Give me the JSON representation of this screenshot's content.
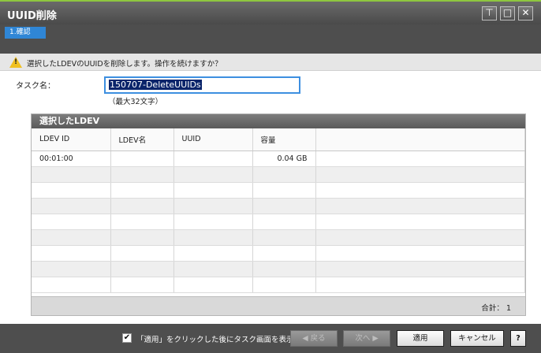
{
  "window": {
    "title": "UUID削除",
    "controls": [
      "pin-icon",
      "maximize-icon",
      "close-icon"
    ]
  },
  "steps": [
    {
      "label": "1.確認",
      "active": true
    }
  ],
  "message": {
    "icon": "warning-icon",
    "text": "選択したLDEVのUUIDを削除します。操作を続けますか？"
  },
  "task": {
    "label": "タスク名：",
    "value": "150707-DeleteUUIDs",
    "hint": "（最大32文字）"
  },
  "table": {
    "title": "選択したLDEV",
    "columns": [
      "LDEV ID",
      "LDEV名",
      "UUID",
      "容量"
    ],
    "rows": [
      {
        "ldev_id": "00:01:00",
        "ldev_name": "",
        "uuid": "",
        "capacity": "0.04 GB"
      }
    ],
    "total_label": "合計：",
    "total_value": "1"
  },
  "footer": {
    "show_task_checkbox_checked": true,
    "show_task_label": "「適用」をクリックした後にタスク画面を表示",
    "back_label": "◀ 戻る",
    "next_label": "次へ ▶",
    "apply_label": "適用",
    "cancel_label": "キャンセル",
    "help_label": "?"
  },
  "colors": {
    "title_bar": "#4a4a4a",
    "step_active": "#2f86d6",
    "input_border": "#3d8fe0",
    "warning": "#f0c020"
  }
}
